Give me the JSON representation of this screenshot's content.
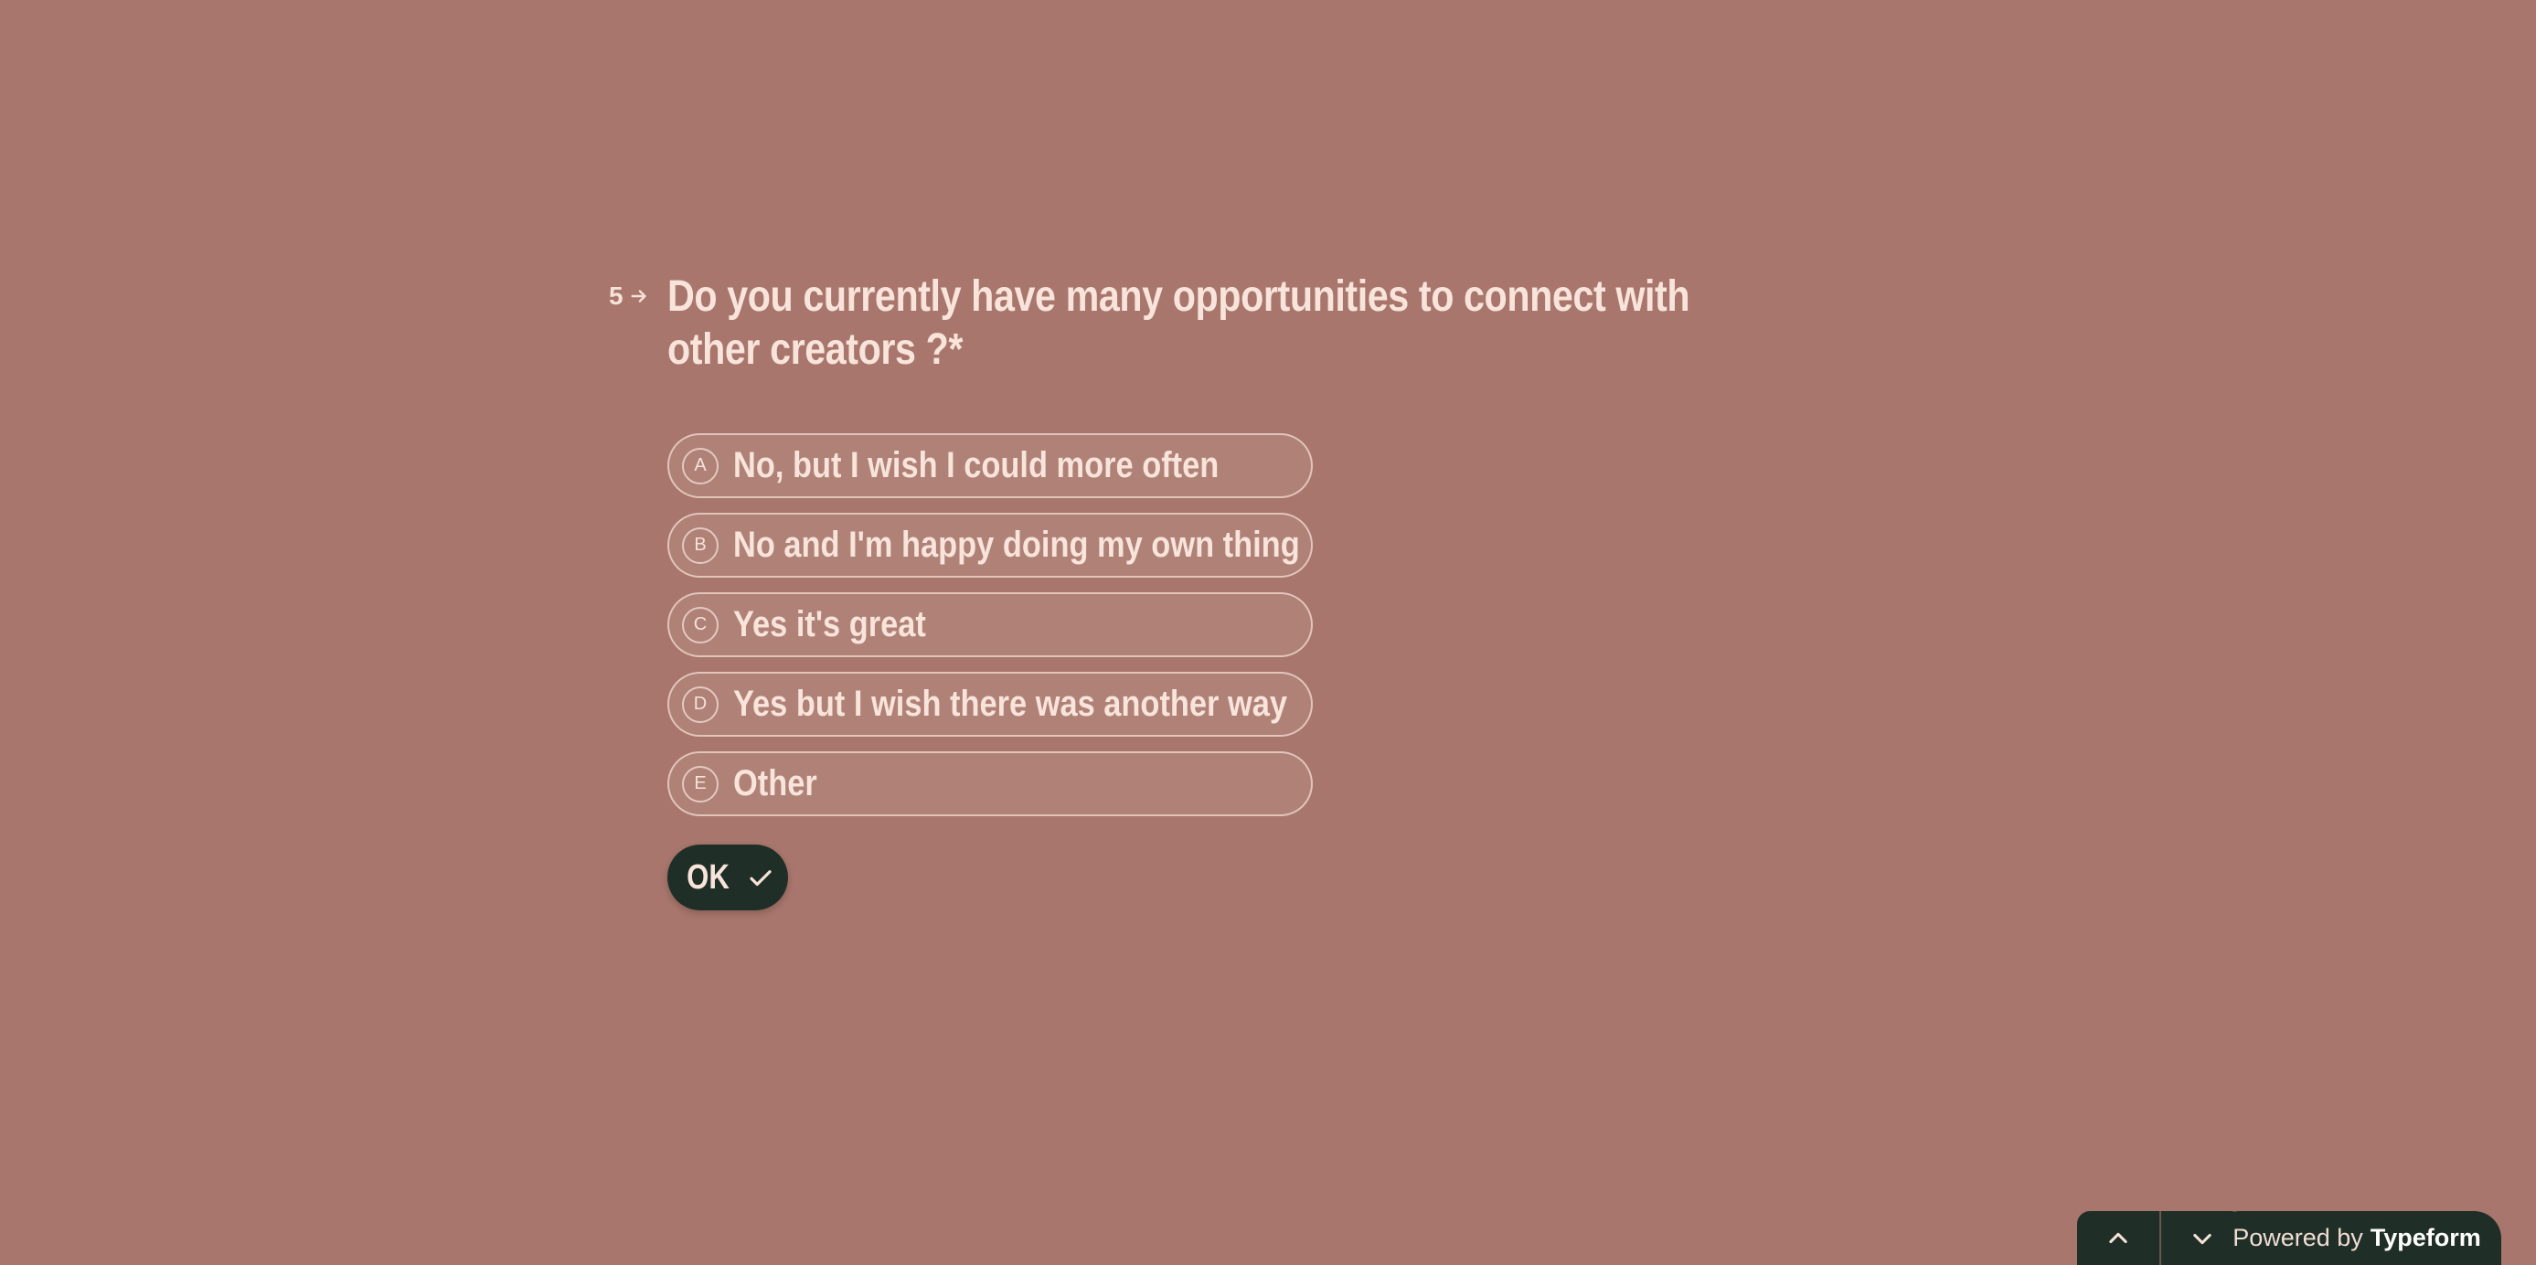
{
  "question": {
    "number": "5",
    "title": "Do you currently have many opportunities to connect with other creators ?*"
  },
  "options": [
    {
      "key": "A",
      "label": "No, but I wish I could more often"
    },
    {
      "key": "B",
      "label": "No and I'm happy doing my own thing"
    },
    {
      "key": "C",
      "label": "Yes it's great"
    },
    {
      "key": "D",
      "label": "Yes but I wish there was another way"
    },
    {
      "key": "E",
      "label": "Other"
    }
  ],
  "submit": {
    "label": "OK",
    "icon": "checkmark-icon"
  },
  "navigation": {
    "up_icon": "chevron-up-icon",
    "down_icon": "chevron-down-icon"
  },
  "branding": {
    "prefix": "Powered by",
    "brand": "Typeform"
  },
  "colors": {
    "background": "#a8766c",
    "text": "#f6e2d8",
    "button": "#1f2f27"
  }
}
